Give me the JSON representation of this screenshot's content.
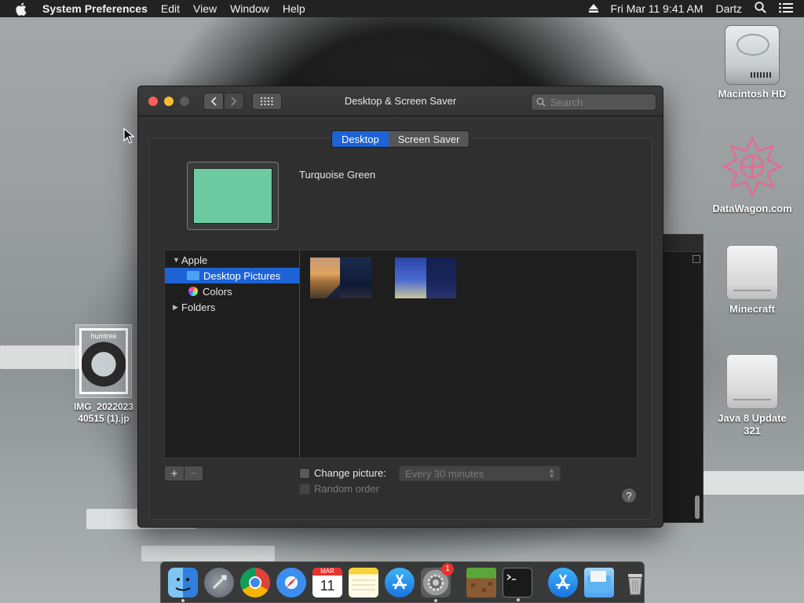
{
  "menubar": {
    "app_name": "System Preferences",
    "menus": [
      "Edit",
      "View",
      "Window",
      "Help"
    ],
    "clock": "Fri Mar 11  9:41 AM",
    "user": "Dartz"
  },
  "desktop_icons": [
    {
      "label": "Macintosh HD",
      "icon": "hard-drive-icon"
    },
    {
      "label": "DataWagon.com",
      "icon": "datawagon-logo-icon"
    },
    {
      "label": "Minecraft",
      "icon": "disk-image-icon"
    },
    {
      "label": "Java 8 Update 321",
      "icon": "disk-image-icon"
    }
  ],
  "dragged_file": {
    "label_line1": "IMG_2022023",
    "label_line2": "40515 (1).jp",
    "thumb_caption": "humtree"
  },
  "window": {
    "title": "Desktop & Screen Saver",
    "search_placeholder": "Search",
    "tabs": [
      {
        "label": "Desktop",
        "active": true
      },
      {
        "label": "Screen Saver",
        "active": false
      }
    ],
    "current_wallpaper": {
      "name": "Turquoise Green",
      "color": "#6cc9a1"
    },
    "source_list": {
      "group_apple": "Apple",
      "desktop_pictures": "Desktop Pictures",
      "colors": "Colors",
      "group_folders": "Folders"
    },
    "thumbnails": [
      "mojave-dunes-thumbnail",
      "blue-sky-thumbnail"
    ],
    "change_picture_label": "Change picture:",
    "change_picture_checked": false,
    "interval_value": "Every 30 minutes",
    "random_order_label": "Random order",
    "add_label": "+",
    "remove_label": "−",
    "help_label": "?"
  },
  "dock": {
    "items": [
      "finder",
      "launchpad",
      "chrome",
      "safari",
      "calendar",
      "notes",
      "app-store",
      "system-preferences",
      "minecraft",
      "terminal",
      "app-store-downloads",
      "downloads-folder",
      "trash"
    ],
    "calendar_month": "MAR",
    "calendar_day": "11",
    "system_preferences_badge": "1"
  },
  "colors": {
    "accent": "#1d63d6",
    "close": "#fc5f57",
    "minimize": "#fdbc2e"
  }
}
